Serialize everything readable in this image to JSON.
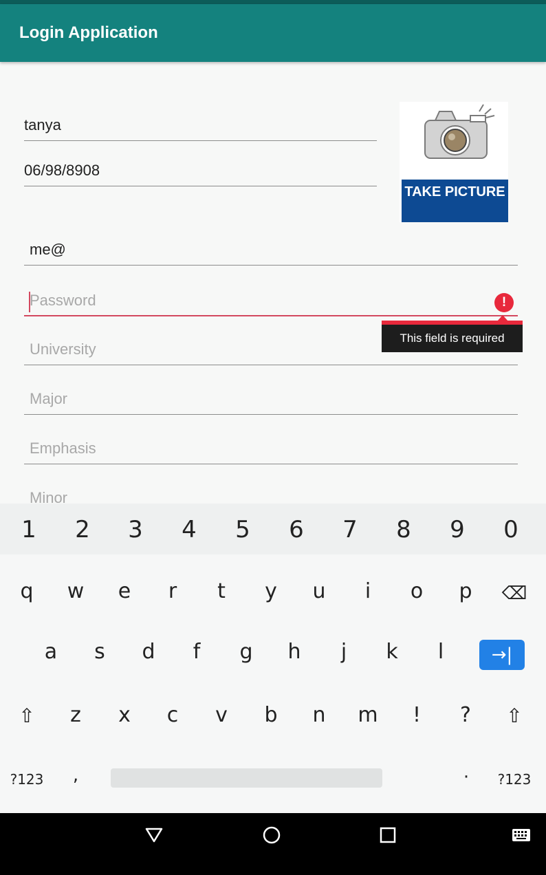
{
  "app": {
    "title": "Login Application"
  },
  "form": {
    "name_value": "tanya",
    "birthdate_value": "06/98/8908",
    "email_value": "me@",
    "password_placeholder": "Password",
    "university_placeholder": "University",
    "major_placeholder": "Major",
    "emphasis_placeholder": "Emphasis",
    "minor_placeholder": "Minor",
    "error_icon": "!",
    "error_message": "This field is required"
  },
  "camera": {
    "label": "TAKE PICTURE",
    "icon": "camera-icon"
  },
  "keyboard": {
    "numbers": [
      "1",
      "2",
      "3",
      "4",
      "5",
      "6",
      "7",
      "8",
      "9",
      "0"
    ],
    "row1": [
      "q",
      "w",
      "e",
      "r",
      "t",
      "y",
      "u",
      "i",
      "o",
      "p"
    ],
    "row2": [
      "a",
      "s",
      "d",
      "f",
      "g",
      "h",
      "j",
      "k",
      "l"
    ],
    "row3": [
      "z",
      "x",
      "c",
      "v",
      "b",
      "n",
      "m",
      "!",
      "?"
    ],
    "backspace_glyph": "⌫",
    "enter_glyph": "→|",
    "shift_glyph": "⇧",
    "symbols_left": "?123",
    "comma": ",",
    "period": "·",
    "symbols_right": "?123",
    "accent_color": "#2281e6"
  },
  "colors": {
    "app_bar": "#14827e",
    "error": "#e8293c",
    "picture_band": "#0d4a93"
  }
}
